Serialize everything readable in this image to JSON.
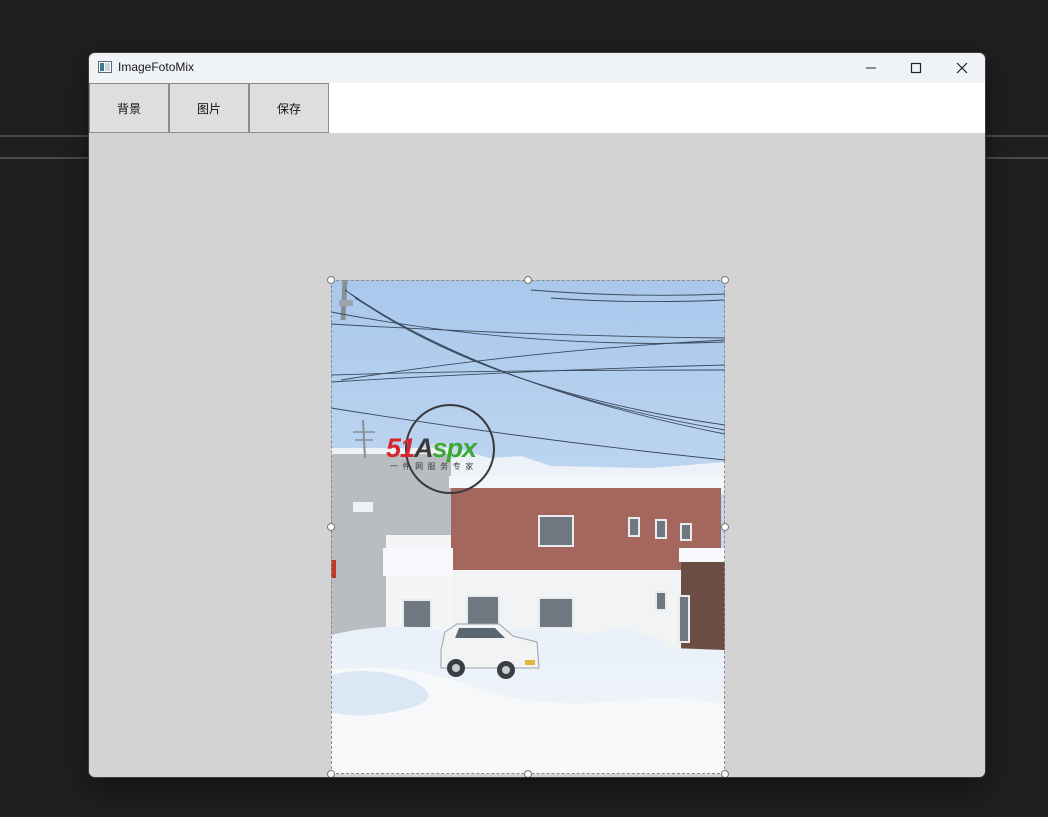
{
  "window": {
    "title": "ImageFotoMix"
  },
  "toolbar": {
    "background_label": "背景",
    "image_label": "图片",
    "save_label": "保存"
  },
  "watermark": {
    "brand_red": "51",
    "brand_dark": "A",
    "brand_green": "spx",
    "tagline": "一 件 网 服 务 专 家"
  },
  "icons": {
    "app": "image-window-icon",
    "minimize": "minimize-icon",
    "maximize": "maximize-icon",
    "close": "close-icon"
  },
  "colors": {
    "canvas_bg": "#d3d3d3",
    "titlebar_bg": "#eff2f7",
    "button_bg": "#dedede",
    "brand_red": "#d9262c",
    "brand_green": "#3aa935"
  }
}
